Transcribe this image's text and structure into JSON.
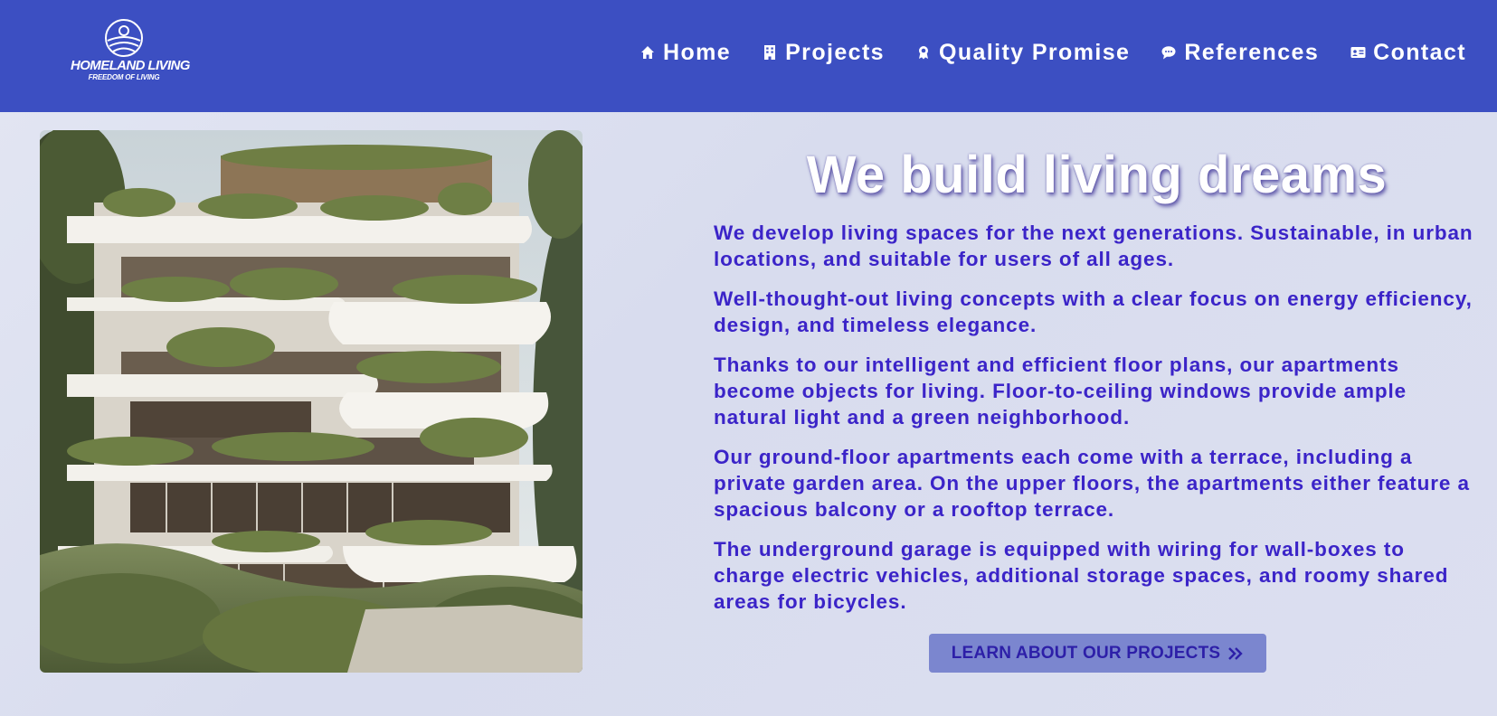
{
  "brand": {
    "name": "HOMELAND LIVING",
    "tagline": "FREEDOM OF LIVING"
  },
  "nav": {
    "items": [
      {
        "label": "Home",
        "icon": "home-icon"
      },
      {
        "label": "Projects",
        "icon": "building-icon"
      },
      {
        "label": "Quality Promise",
        "icon": "award-icon"
      },
      {
        "label": "References",
        "icon": "speech-bubble-icon"
      },
      {
        "label": "Contact",
        "icon": "contact-card-icon"
      }
    ]
  },
  "hero": {
    "image_alt": "Modern residential building with green terraces",
    "headline": "We build living dreams",
    "paragraphs": [
      "We develop living spaces for the next generations. Sustainable, in urban locations, and suitable for users of all ages.",
      "Well-thought-out living concepts with a clear focus on energy efficiency, design, and timeless elegance.",
      "Thanks to our intelligent and efficient floor plans, our apartments become objects for living. Floor-to-ceiling windows provide ample natural light and a green neighborhood.",
      "Our ground-floor apartments each come with a terrace, including a private garden area. On the upper floors, the apartments either feature a spacious balcony or a rooftop terrace.",
      "The underground garage is equipped with wiring for wall-boxes to charge electric vehicles, additional storage spaces, and roomy shared areas for bicycles."
    ],
    "cta_label": "LEARN ABOUT OUR PROJECTS",
    "cta_icon": "double-chevron-right-icon"
  },
  "colors": {
    "header_bg": "#3c4fc2",
    "text_accent": "#3b24c8",
    "button_bg": "#7b86cf"
  }
}
